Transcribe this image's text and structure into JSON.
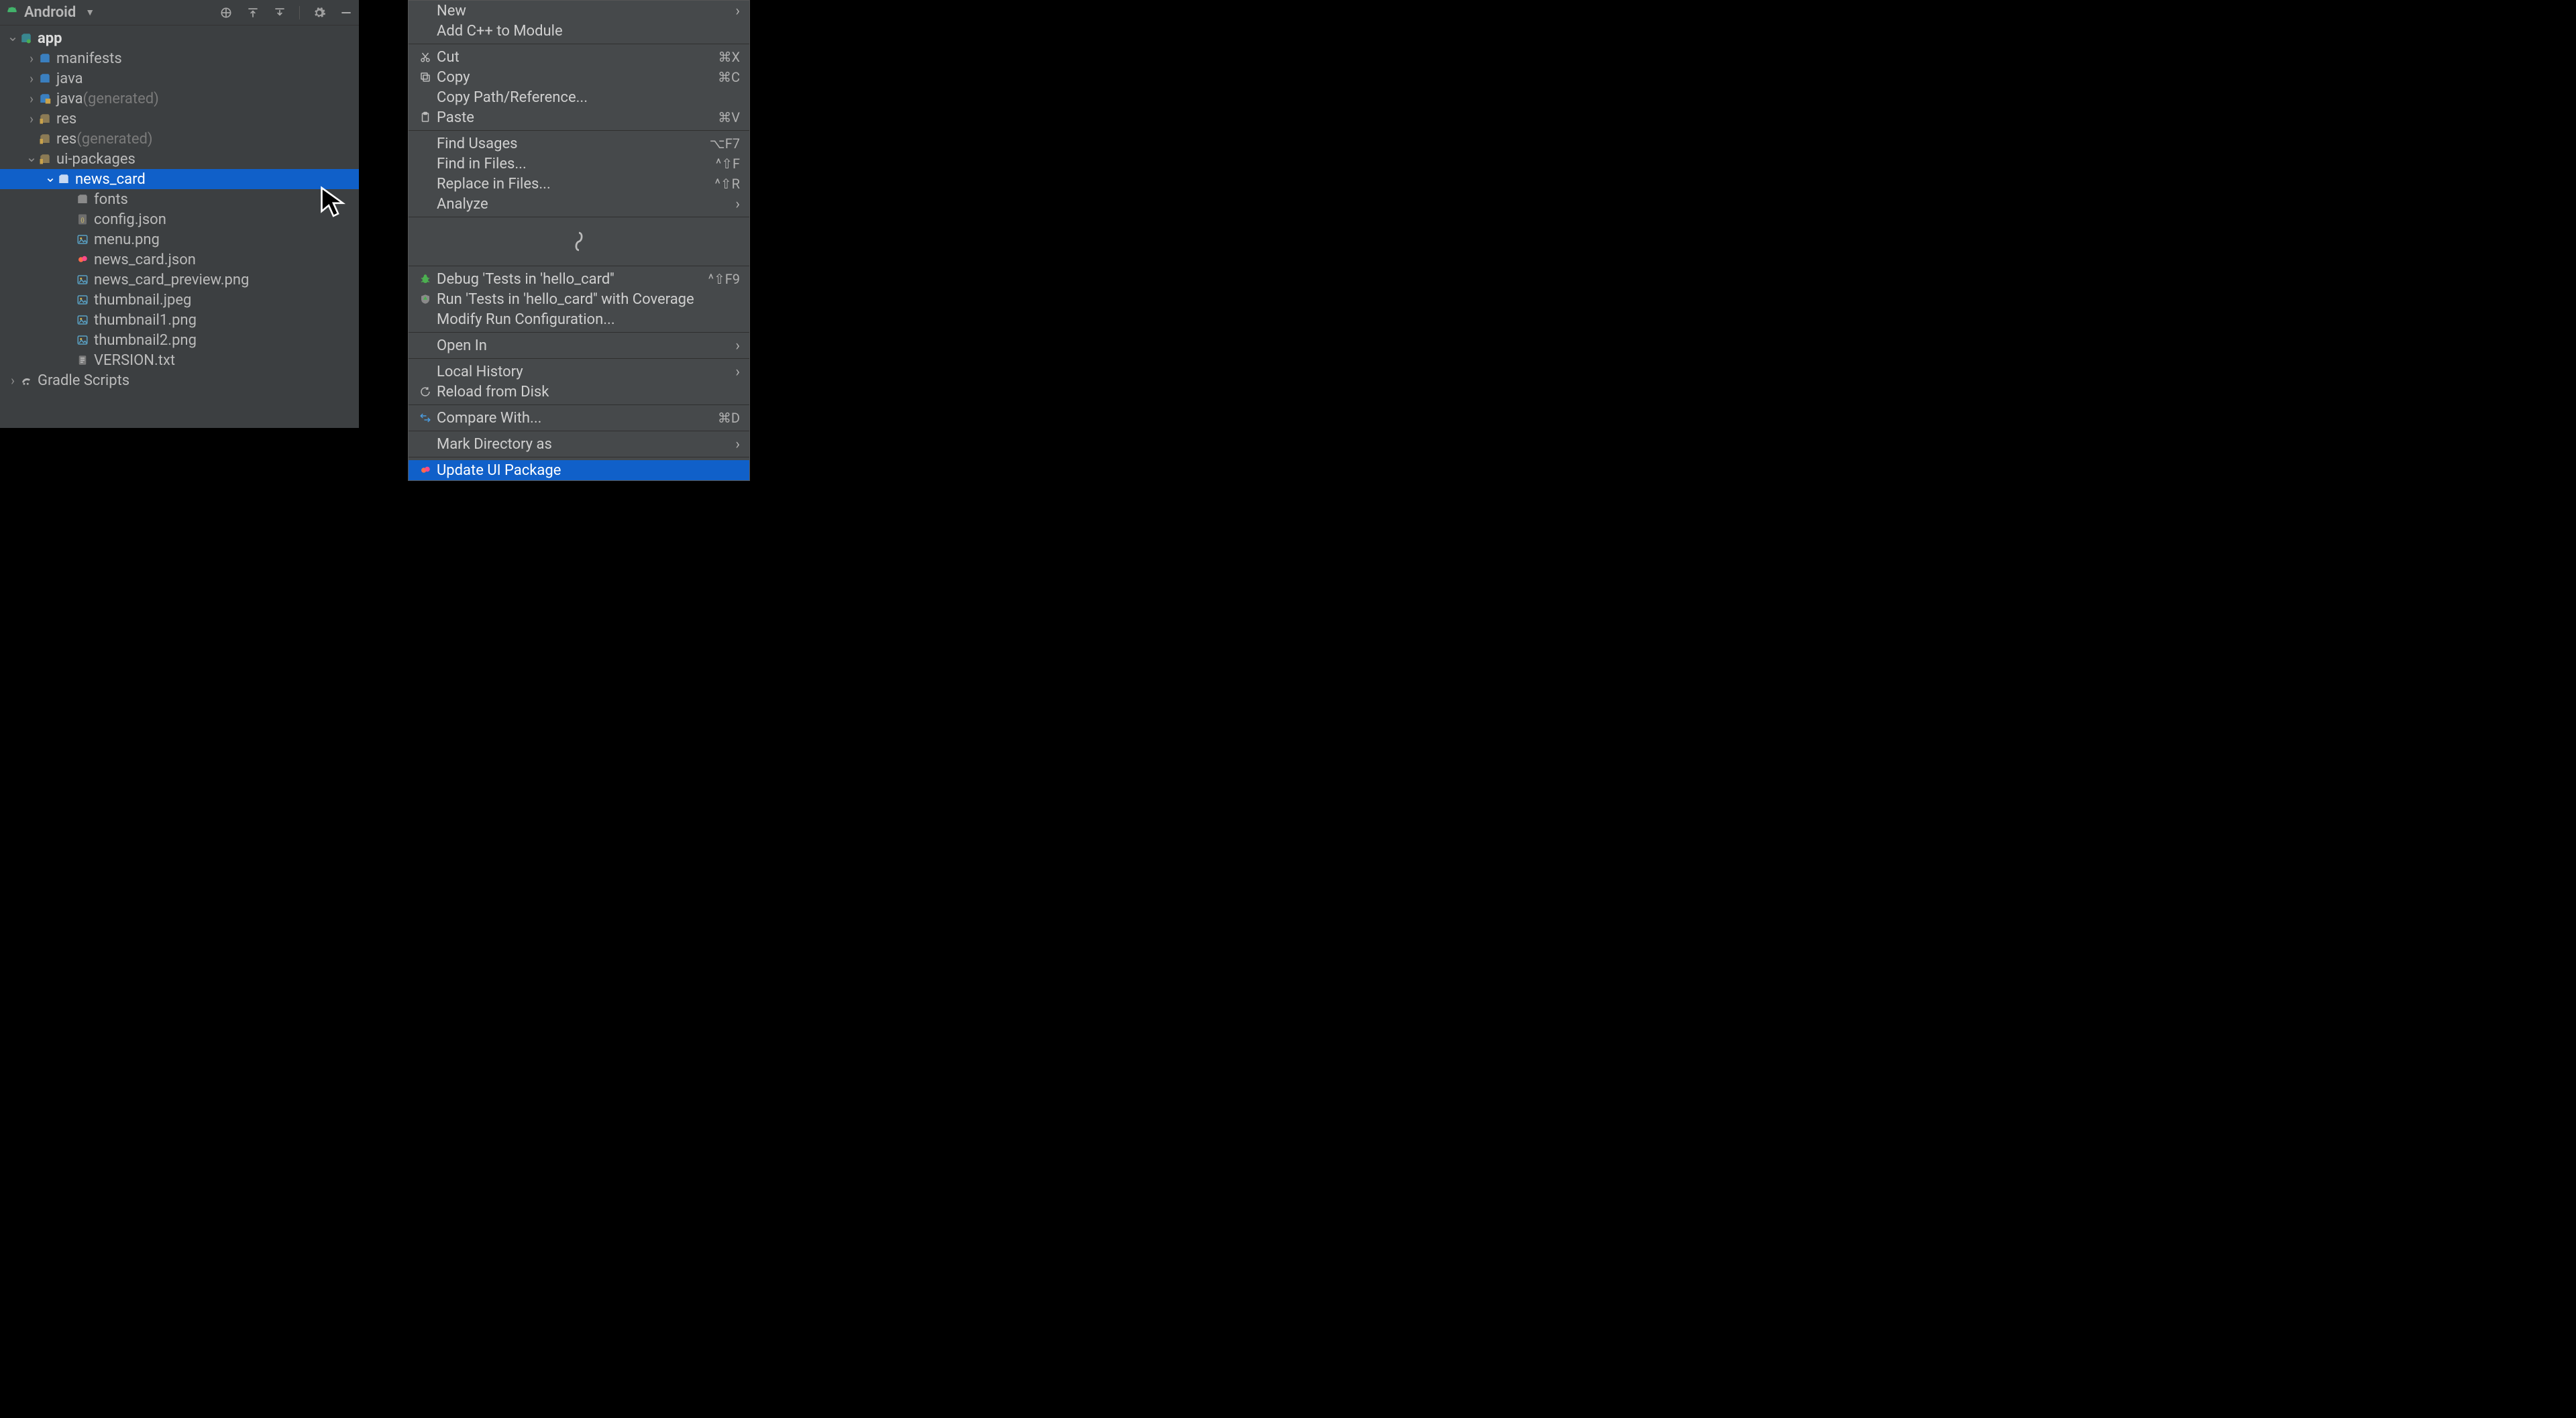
{
  "panel": {
    "title": "Android",
    "tree": [
      {
        "depth": 0,
        "chev": "down",
        "icon": "module",
        "label": "app",
        "bold": true
      },
      {
        "depth": 1,
        "chev": "right",
        "icon": "folder-blue",
        "label": "manifests"
      },
      {
        "depth": 1,
        "chev": "right",
        "icon": "folder-blue",
        "label": "java"
      },
      {
        "depth": 1,
        "chev": "right",
        "icon": "folder-gen",
        "label": "java",
        "suffix": " (generated)"
      },
      {
        "depth": 1,
        "chev": "right",
        "icon": "folder-res",
        "label": "res"
      },
      {
        "depth": 1,
        "chev": "none",
        "icon": "folder-res",
        "label": "res",
        "suffix": " (generated)"
      },
      {
        "depth": 1,
        "chev": "down",
        "icon": "folder-res",
        "label": "ui-packages"
      },
      {
        "depth": 2,
        "chev": "down",
        "icon": "folder-gray",
        "label": "news_card",
        "selected": true
      },
      {
        "depth": 3,
        "chev": "none",
        "icon": "folder-gray",
        "label": "fonts"
      },
      {
        "depth": 3,
        "chev": "none",
        "icon": "file-json",
        "label": "config.json"
      },
      {
        "depth": 3,
        "chev": "none",
        "icon": "file-image",
        "label": "menu.png"
      },
      {
        "depth": 3,
        "chev": "none",
        "icon": "file-relay",
        "label": "news_card.json"
      },
      {
        "depth": 3,
        "chev": "none",
        "icon": "file-image",
        "label": "news_card_preview.png"
      },
      {
        "depth": 3,
        "chev": "none",
        "icon": "file-image",
        "label": "thumbnail.jpeg"
      },
      {
        "depth": 3,
        "chev": "none",
        "icon": "file-image",
        "label": "thumbnail1.png"
      },
      {
        "depth": 3,
        "chev": "none",
        "icon": "file-image",
        "label": "thumbnail2.png"
      },
      {
        "depth": 3,
        "chev": "none",
        "icon": "file-text",
        "label": "VERSION.txt"
      },
      {
        "depth": 0,
        "chev": "right",
        "icon": "gradle",
        "label": "Gradle Scripts"
      }
    ]
  },
  "context_menu": [
    {
      "type": "item",
      "label": "New",
      "submenu": true
    },
    {
      "type": "item",
      "label": "Add C++ to Module"
    },
    {
      "type": "sep"
    },
    {
      "type": "item",
      "icon": "cut",
      "label": "Cut",
      "shortcut": "⌘X"
    },
    {
      "type": "item",
      "icon": "copy",
      "label": "Copy",
      "shortcut": "⌘C"
    },
    {
      "type": "item",
      "label": "Copy Path/Reference..."
    },
    {
      "type": "item",
      "icon": "paste",
      "label": "Paste",
      "shortcut": "⌘V"
    },
    {
      "type": "sep"
    },
    {
      "type": "item",
      "label": "Find Usages",
      "shortcut": "⌥F7"
    },
    {
      "type": "item",
      "label": "Find in Files...",
      "shortcut": "^⇧F"
    },
    {
      "type": "item",
      "label": "Replace in Files...",
      "shortcut": "^⇧R"
    },
    {
      "type": "item",
      "label": "Analyze",
      "submenu": true
    },
    {
      "type": "sep"
    },
    {
      "type": "spinner"
    },
    {
      "type": "sep"
    },
    {
      "type": "item",
      "icon": "bug",
      "label": "Debug 'Tests in 'hello_card''",
      "shortcut": "^⇧F9"
    },
    {
      "type": "item",
      "icon": "coverage",
      "label": "Run 'Tests in 'hello_card'' with Coverage"
    },
    {
      "type": "item",
      "label": "Modify Run Configuration..."
    },
    {
      "type": "sep"
    },
    {
      "type": "item",
      "label": "Open In",
      "submenu": true
    },
    {
      "type": "sep"
    },
    {
      "type": "item",
      "label": "Local History",
      "submenu": true
    },
    {
      "type": "item",
      "icon": "reload",
      "label": "Reload from Disk"
    },
    {
      "type": "sep"
    },
    {
      "type": "item",
      "icon": "compare",
      "label": "Compare With...",
      "shortcut": "⌘D"
    },
    {
      "type": "sep"
    },
    {
      "type": "item",
      "label": "Mark Directory as",
      "submenu": true
    },
    {
      "type": "sep"
    },
    {
      "type": "item",
      "icon": "relay",
      "label": "Update UI Package",
      "highlight": true
    }
  ]
}
